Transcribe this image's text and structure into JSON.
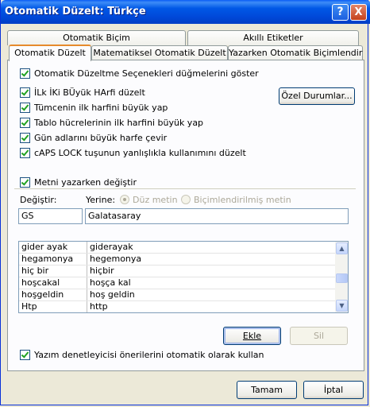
{
  "window": {
    "title": "Otomatik Düzelt: Türkçe"
  },
  "titlebar": {
    "help_glyph": "?",
    "close_glyph": "X"
  },
  "tabs": {
    "row1": [
      "Otomatik Biçim",
      "Akıllı Etiketler"
    ],
    "row2": [
      "Otomatik Düzelt",
      "Matematiksel Otomatik Düzelt",
      "Yazarken Otomatik Biçimlendir"
    ],
    "active": "Otomatik Düzelt"
  },
  "options": {
    "show_buttons": {
      "label": "Otomatik Düzeltme Seçenekleri düğmelerini göster",
      "checked": true
    },
    "two_initials": {
      "label": "İLk İKi BÜyük HArfi düzelt",
      "checked": true
    },
    "sentence_caps": {
      "label": "Tümcenin ilk harfini büyük yap",
      "checked": true
    },
    "table_caps": {
      "label": "Tablo hücrelerinin ilk harfini büyük yap",
      "checked": true
    },
    "day_caps": {
      "label": "Gün adlarını büyük harfe çevir",
      "checked": true
    },
    "caps_lock": {
      "label": "cAPS LOCK tuşunun yanlışlıkla kullanımını düzelt",
      "checked": true
    },
    "exceptions_button": "Özel Durumlar..."
  },
  "replace": {
    "toggle": {
      "label": "Metni yazarken değiştir",
      "checked": true
    },
    "replace_label": "Değiştir:",
    "with_label": "Yerine:",
    "plain_text": "Düz metin",
    "formatted_text": "Biçimlendirilmiş metin",
    "replace_value": "GS",
    "with_value": "Galatasaray",
    "entries": [
      {
        "from": "gider ayak",
        "to": "giderayak"
      },
      {
        "from": "hegamonya",
        "to": "hegemonya"
      },
      {
        "from": "hiç bir",
        "to": "hiçbir"
      },
      {
        "from": "hoşcakal",
        "to": "hoşça kal"
      },
      {
        "from": "hoşgeldin",
        "to": "hoş geldin"
      },
      {
        "from": "Htp",
        "to": "http"
      }
    ],
    "add_button": "Ekle",
    "delete_button": "Sil"
  },
  "spelling": {
    "label": "Yazım denetleyicisi önerilerini otomatik olarak kullan",
    "checked": true
  },
  "footer": {
    "ok": "Tamam",
    "cancel": "İptal"
  }
}
